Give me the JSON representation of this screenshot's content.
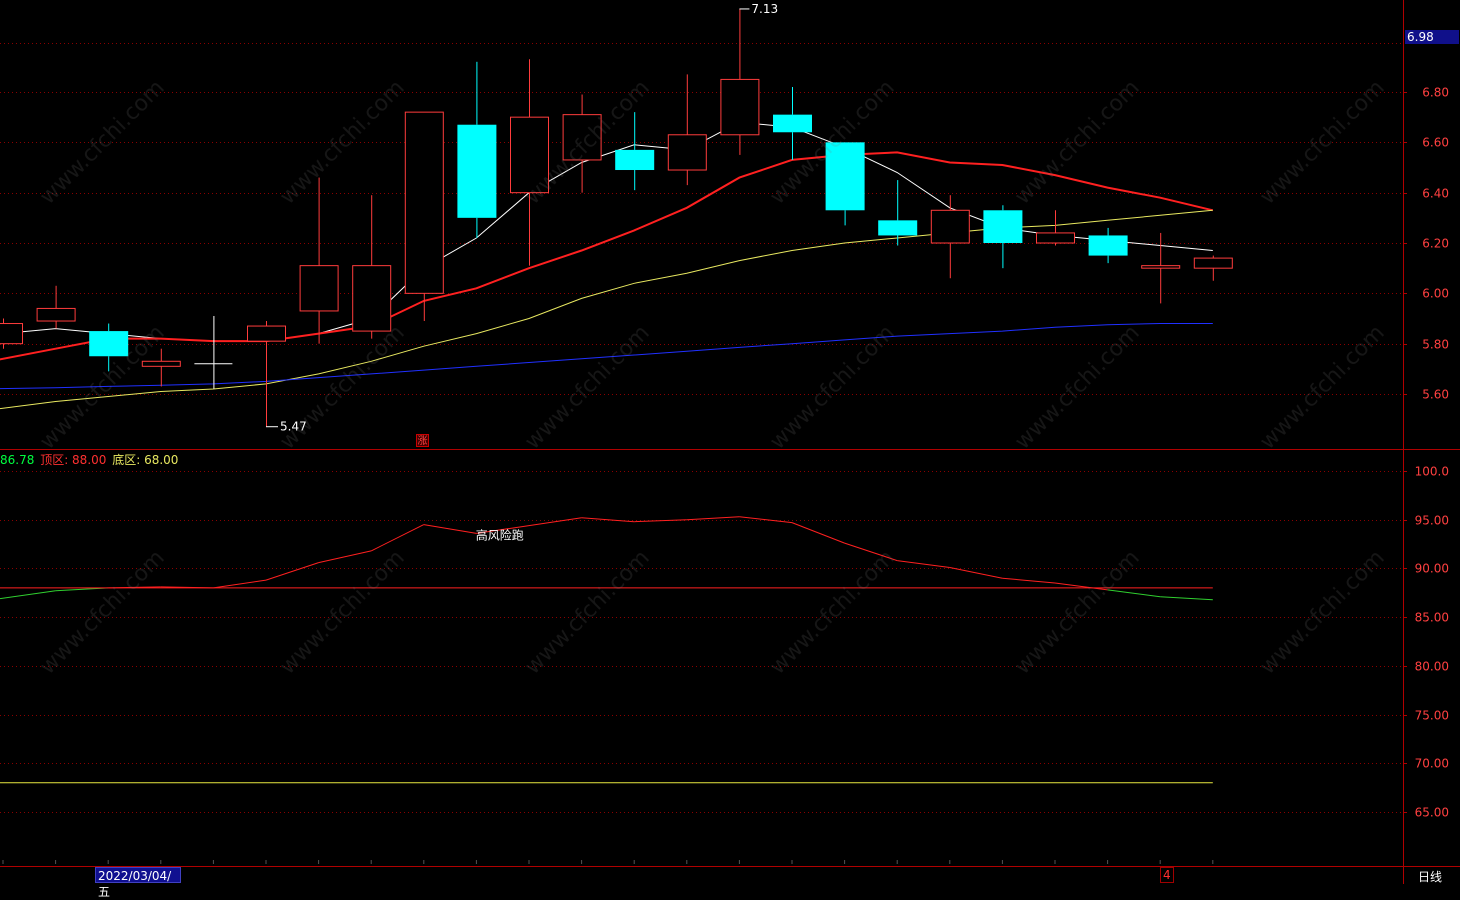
{
  "price_axis": {
    "ticks": [
      "6.80",
      "6.60",
      "6.40",
      "6.20",
      "6.00",
      "5.80",
      "5.60"
    ],
    "current_price": "6.98"
  },
  "osc_axis": {
    "ticks": [
      "100.0",
      "95.00",
      "90.00",
      "85.00",
      "80.00",
      "75.00",
      "70.00",
      "65.00"
    ]
  },
  "legend": {
    "value": "86.78",
    "top_label": "顶区: 88.00",
    "bottom_label": "底区: 68.00"
  },
  "annotations": {
    "high": "7.13",
    "low": "5.47",
    "signal_text": "高风险跑",
    "rise_mark": "涨"
  },
  "footer": {
    "date": "2022/03/04/五",
    "marker": "4",
    "period": "日线"
  },
  "watermark_text": "www.cfchi.com",
  "colors": {
    "bg": "#000000",
    "up": "#ff3c3c",
    "down": "#00ffff",
    "ma5": "#ffffff",
    "ma10": "#ff2020",
    "ma20": "#e8e860",
    "ma60": "#2030ff",
    "grid": "#8a0000",
    "axis": "#b00000"
  },
  "chart_data": [
    {
      "type": "candlestick",
      "title": "",
      "ylim": [
        5.42,
        7.18
      ],
      "candles": [
        {
          "o": 5.8,
          "c": 5.88,
          "h": 5.9,
          "l": 5.78
        },
        {
          "o": 5.89,
          "c": 5.94,
          "h": 6.03,
          "l": 5.86
        },
        {
          "o": 5.85,
          "c": 5.75,
          "h": 5.88,
          "l": 5.69
        },
        {
          "o": 5.71,
          "c": 5.73,
          "h": 5.78,
          "l": 5.63
        },
        {
          "o": 5.72,
          "c": 5.72,
          "h": 5.91,
          "l": 5.62
        },
        {
          "o": 5.81,
          "c": 5.87,
          "h": 5.89,
          "l": 5.47
        },
        {
          "o": 5.93,
          "c": 6.11,
          "h": 6.46,
          "l": 5.8
        },
        {
          "o": 5.85,
          "c": 6.11,
          "h": 6.39,
          "l": 5.82
        },
        {
          "o": 6.0,
          "c": 6.72,
          "h": 6.72,
          "l": 5.89
        },
        {
          "o": 6.67,
          "c": 6.3,
          "h": 6.92,
          "l": 6.22
        },
        {
          "o": 6.4,
          "c": 6.7,
          "h": 6.93,
          "l": 6.11
        },
        {
          "o": 6.53,
          "c": 6.71,
          "h": 6.79,
          "l": 6.4
        },
        {
          "o": 6.57,
          "c": 6.49,
          "h": 6.72,
          "l": 6.41
        },
        {
          "o": 6.49,
          "c": 6.63,
          "h": 6.87,
          "l": 6.43
        },
        {
          "o": 6.63,
          "c": 6.85,
          "h": 7.13,
          "l": 6.55
        },
        {
          "o": 6.71,
          "c": 6.64,
          "h": 6.82,
          "l": 6.53
        },
        {
          "o": 6.6,
          "c": 6.33,
          "h": 6.6,
          "l": 6.27
        },
        {
          "o": 6.29,
          "c": 6.23,
          "h": 6.45,
          "l": 6.19
        },
        {
          "o": 6.2,
          "c": 6.33,
          "h": 6.39,
          "l": 6.06
        },
        {
          "o": 6.33,
          "c": 6.2,
          "h": 6.35,
          "l": 6.1
        },
        {
          "o": 6.2,
          "c": 6.24,
          "h": 6.33,
          "l": 6.19
        },
        {
          "o": 6.23,
          "c": 6.15,
          "h": 6.26,
          "l": 6.12
        },
        {
          "o": 6.1,
          "c": 6.11,
          "h": 6.24,
          "l": 5.96
        },
        {
          "o": 6.1,
          "c": 6.14,
          "h": 6.15,
          "l": 6.05
        }
      ],
      "series": [
        {
          "key": "ma5",
          "values": [
            5.83,
            5.86,
            5.84,
            5.82,
            5.81,
            5.81,
            5.84,
            5.9,
            6.1,
            6.22,
            6.4,
            6.52,
            6.59,
            6.57,
            6.68,
            6.66,
            6.58,
            6.48,
            6.34,
            6.26,
            6.23,
            6.21,
            6.19,
            6.17
          ]
        },
        {
          "key": "ma10",
          "values": [
            5.72,
            5.78,
            5.82,
            5.82,
            5.81,
            5.81,
            5.84,
            5.87,
            5.97,
            6.02,
            6.1,
            6.17,
            6.25,
            6.34,
            6.46,
            6.53,
            6.55,
            6.56,
            6.52,
            6.51,
            6.47,
            6.42,
            6.38,
            6.33
          ]
        },
        {
          "key": "ma20",
          "values": [
            5.53,
            5.57,
            5.59,
            5.61,
            5.62,
            5.64,
            5.68,
            5.73,
            5.79,
            5.84,
            5.9,
            5.98,
            6.04,
            6.08,
            6.13,
            6.17,
            6.2,
            6.22,
            6.24,
            6.26,
            6.27,
            6.29,
            6.31,
            6.33
          ]
        },
        {
          "key": "ma60",
          "values": [
            5.62,
            5.625,
            5.63,
            5.635,
            5.64,
            5.65,
            5.665,
            5.68,
            5.695,
            5.71,
            5.725,
            5.74,
            5.755,
            5.77,
            5.785,
            5.8,
            5.815,
            5.83,
            5.84,
            5.85,
            5.865,
            5.875,
            5.88,
            5.88
          ]
        }
      ]
    },
    {
      "type": "line",
      "title": "",
      "ylim": [
        60,
        101
      ],
      "series": [
        {
          "key": "osc",
          "values": [
            86.9,
            87.7,
            88.0,
            88.1,
            88.0,
            88.8,
            90.6,
            91.8,
            94.5,
            93.6,
            94.4,
            95.2,
            94.8,
            95.0,
            95.3,
            94.7,
            92.6,
            90.8,
            90.1,
            89.0,
            88.5,
            87.8,
            87.1,
            86.78
          ]
        },
        {
          "key": "top",
          "values": [
            88,
            88,
            88,
            88,
            88,
            88,
            88,
            88,
            88,
            88,
            88,
            88,
            88,
            88,
            88,
            88,
            88,
            88,
            88,
            88,
            88,
            88,
            88,
            88
          ]
        },
        {
          "key": "bottom",
          "values": [
            68,
            68,
            68,
            68,
            68,
            68,
            68,
            68,
            68,
            68,
            68,
            68,
            68,
            68,
            68,
            68,
            68,
            68,
            68,
            68,
            68,
            68,
            68,
            68
          ]
        }
      ]
    }
  ]
}
